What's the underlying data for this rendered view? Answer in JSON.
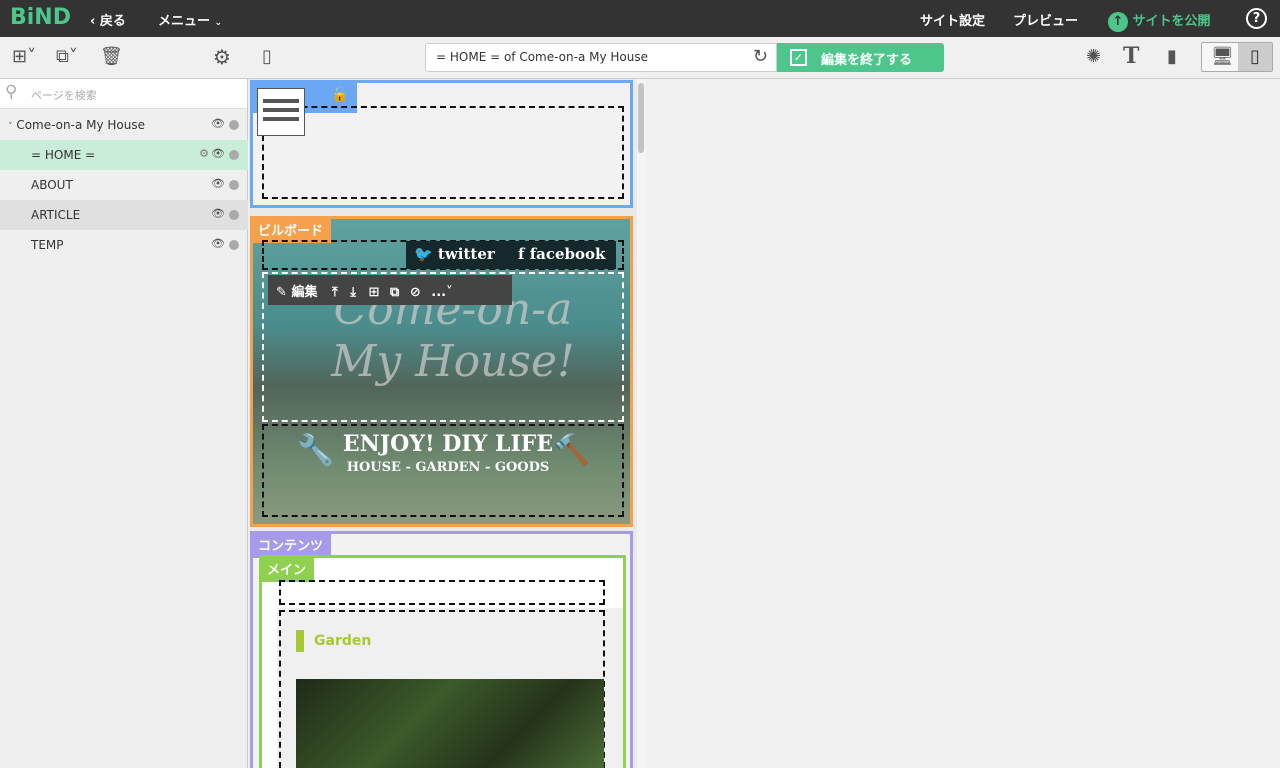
{
  "topbar": {
    "logo": "BiND",
    "back": "戻る",
    "menu": "メニュー",
    "site_settings": "サイト設定",
    "preview": "プレビュー",
    "publish": "サイトを公開",
    "help": "?"
  },
  "toolbar": {
    "url": "= HOME = of Come-on-a My House",
    "done": "編集を終了する"
  },
  "sidebar": {
    "search_placeholder": "ページを検索",
    "items": [
      {
        "label": "Come-on-a My House"
      },
      {
        "label": "= HOME ="
      },
      {
        "label": "ABOUT"
      },
      {
        "label": "ARTICLE"
      },
      {
        "label": "TEMP"
      }
    ]
  },
  "canvas": {
    "billboard_label": "ビルボード",
    "twitter": "twitter",
    "facebook": "facebook",
    "edit": "編集",
    "more": "...",
    "headline": "ENJOY! DIY LIFE",
    "subline": "HOUSE - GARDEN - GOODS",
    "script_title": "Come-on-a My House!",
    "contents_label": "コンテンツ",
    "main_label": "メイン",
    "garden": "Garden"
  },
  "colors": {
    "brand": "#4cc68a",
    "header": "#6aa7f5",
    "billboard": "#f5a04a",
    "contents": "#a59bea",
    "main": "#8fd14f"
  }
}
